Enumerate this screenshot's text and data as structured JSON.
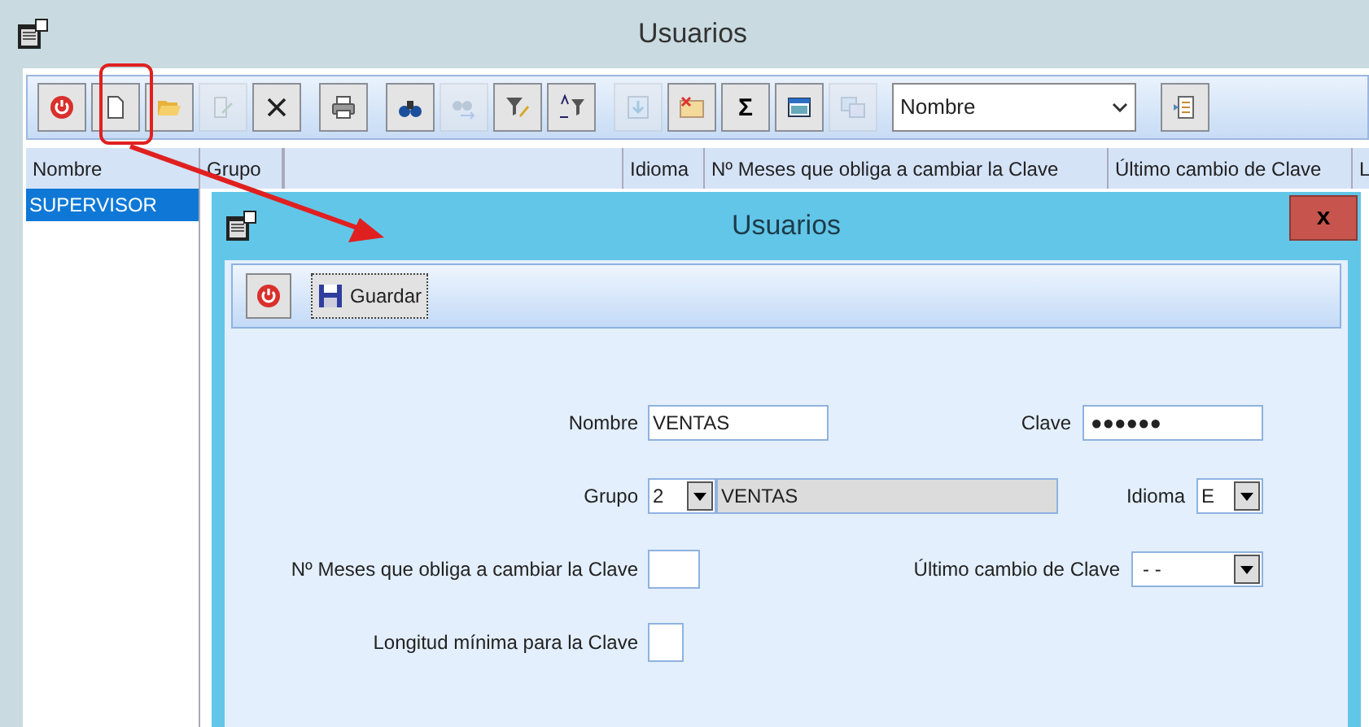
{
  "window": {
    "title": "Usuarios"
  },
  "toolbar": {
    "groups": [
      {
        "buttons": [
          {
            "kind": "power",
            "disabled": false
          },
          {
            "kind": "new",
            "disabled": false
          },
          {
            "kind": "open",
            "disabled": false
          },
          {
            "kind": "edit",
            "disabled": true
          },
          {
            "kind": "delete",
            "disabled": false
          }
        ]
      },
      {
        "buttons": [
          {
            "kind": "print",
            "disabled": false
          }
        ]
      },
      {
        "buttons": [
          {
            "kind": "find",
            "disabled": false
          },
          {
            "kind": "findnext",
            "disabled": true
          },
          {
            "kind": "filter",
            "disabled": false
          },
          {
            "kind": "sort",
            "disabled": false
          }
        ]
      },
      {
        "buttons": [
          {
            "kind": "down",
            "disabled": true
          },
          {
            "kind": "mail",
            "disabled": false
          },
          {
            "kind": "sigma",
            "label": "Σ",
            "disabled": false
          },
          {
            "kind": "window",
            "disabled": false
          },
          {
            "kind": "copy",
            "disabled": true
          }
        ]
      }
    ],
    "search_field": {
      "value": "Nombre"
    }
  },
  "table": {
    "columns": [
      {
        "label": "Nombre"
      },
      {
        "label": "Grupo"
      },
      {
        "kind": "blank"
      },
      {
        "label": "Idioma"
      },
      {
        "label": "Nº Meses que obliga a cambiar la Clave"
      },
      {
        "label": "Último cambio de Clave"
      },
      {
        "label": "L"
      }
    ],
    "rows": [
      {
        "cells": [
          "SUPERVISOR"
        ],
        "selected": true
      }
    ]
  },
  "dialog": {
    "title": "Usuarios",
    "close": "x",
    "toolbar": {
      "save": "Guardar"
    },
    "form": {
      "nombre": {
        "label": "Nombre",
        "value": "VENTAS"
      },
      "clave": {
        "label": "Clave",
        "value": "●●●●●●"
      },
      "grupo": {
        "label": "Grupo",
        "code": "2",
        "name": "VENTAS"
      },
      "idioma": {
        "label": "Idioma",
        "value": "E"
      },
      "meses": {
        "label": "Nº Meses que obliga a cambiar la Clave"
      },
      "ultimo": {
        "label": "Último cambio de Clave",
        "value": "- -"
      },
      "longitud": {
        "label": "Longitud mínima para la Clave"
      }
    }
  }
}
